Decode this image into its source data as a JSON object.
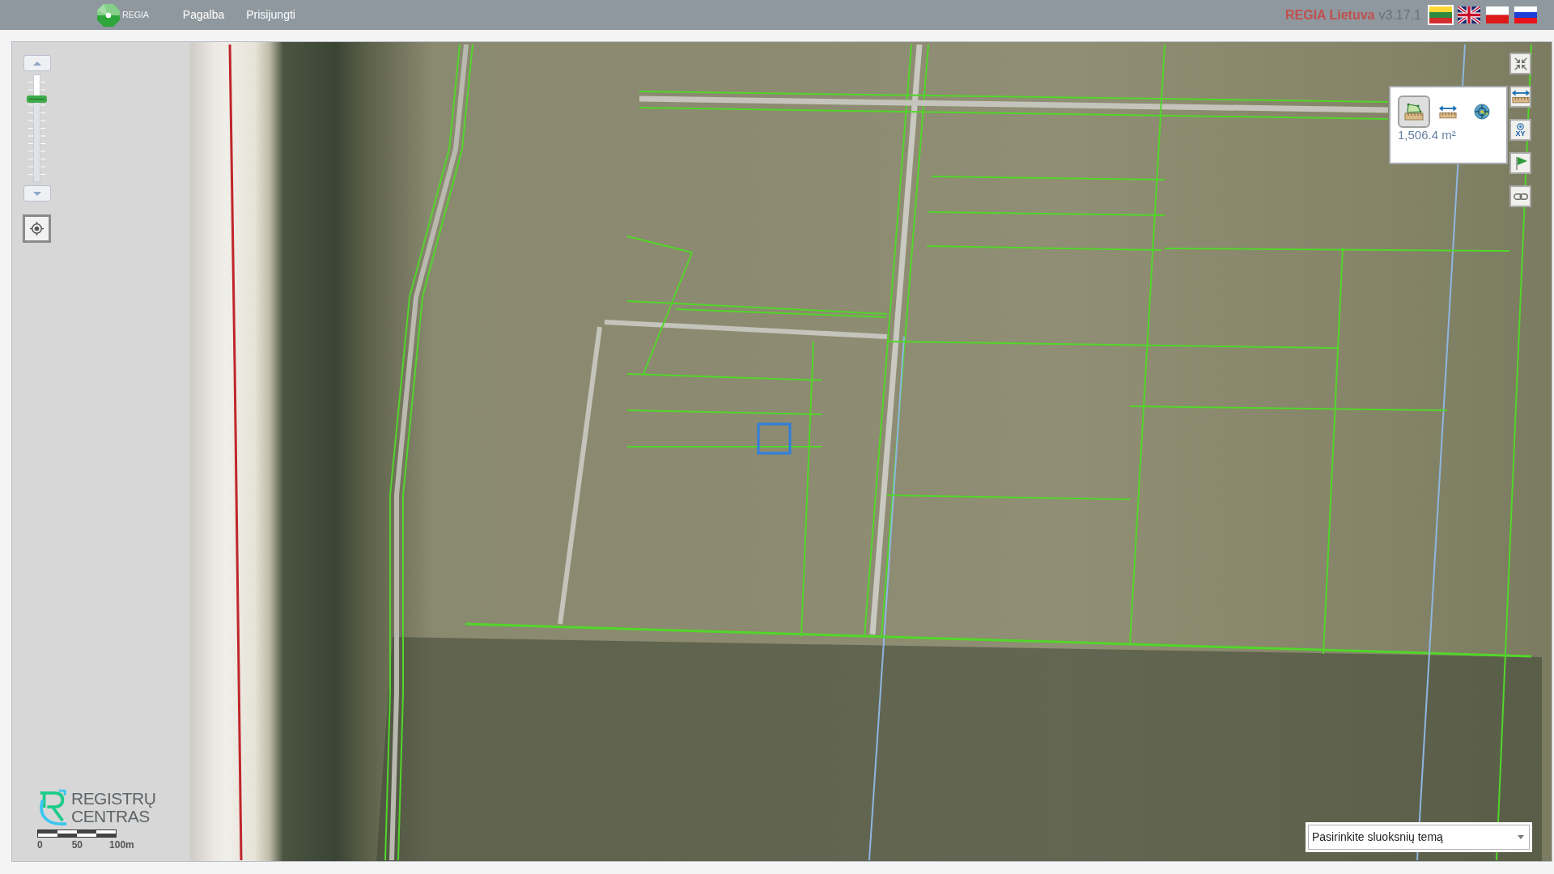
{
  "header": {
    "logo_text": "REGIA",
    "menu": [
      {
        "label": "Pagalba"
      },
      {
        "label": "Prisijungti"
      }
    ],
    "app_name": "REGIA Lietuva",
    "version": "v3.17.1",
    "languages": [
      {
        "kind": "lt",
        "selected": true
      },
      {
        "kind": "gb",
        "selected": false
      },
      {
        "kind": "pl",
        "selected": false
      },
      {
        "kind": "ru",
        "selected": false
      }
    ]
  },
  "zoom_control": {
    "level": 0.77
  },
  "toolbar": [
    {
      "kind": "fullscreen"
    },
    {
      "kind": "distance"
    },
    {
      "kind": "coordinates",
      "label": "XY"
    },
    {
      "kind": "marker"
    },
    {
      "kind": "link"
    }
  ],
  "measure_popup": {
    "tools": [
      {
        "kind": "area",
        "selected": true
      },
      {
        "kind": "distance",
        "selected": false
      },
      {
        "kind": "position",
        "selected": false
      }
    ],
    "result": "1,506.4 m²"
  },
  "branding": {
    "line_1": "REGISTRŲ",
    "line_2": "CENTRAS"
  },
  "scale_bar": {
    "labels": [
      "0",
      "50",
      "100m"
    ]
  },
  "layer_theme_select": {
    "value": "Pasirinkite sluoksnių temą"
  }
}
